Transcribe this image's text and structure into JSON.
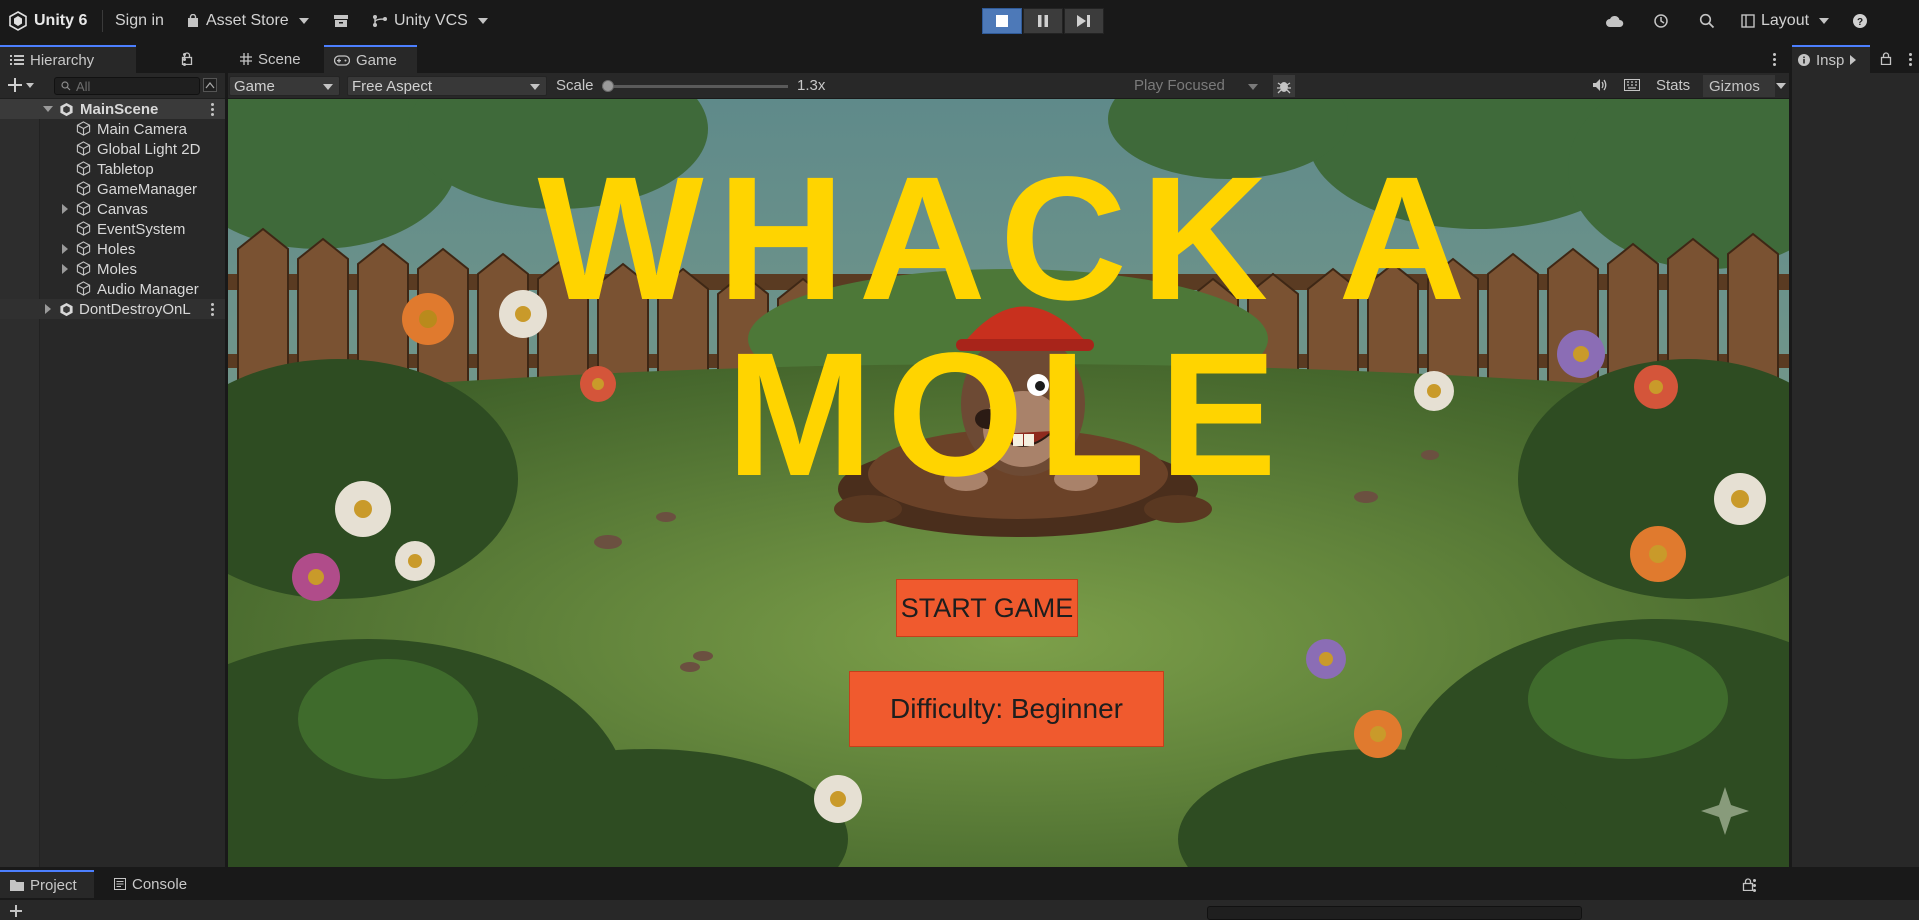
{
  "topbar": {
    "unity_label": "Unity 6",
    "sign_in": "Sign in",
    "asset_store": "Asset Store",
    "vcs": "Unity VCS",
    "layout": "Layout"
  },
  "hierarchy": {
    "tab": "Hierarchy",
    "search_placeholder": "All",
    "scene": "MainScene",
    "items": [
      {
        "label": "Main Camera",
        "expandable": false
      },
      {
        "label": "Global Light 2D",
        "expandable": false
      },
      {
        "label": "Tabletop",
        "expandable": false
      },
      {
        "label": "GameManager",
        "expandable": false
      },
      {
        "label": "Canvas",
        "expandable": true
      },
      {
        "label": "EventSystem",
        "expandable": false
      },
      {
        "label": "Holes",
        "expandable": true
      },
      {
        "label": "Moles",
        "expandable": true
      },
      {
        "label": "Audio Manager",
        "expandable": false
      }
    ],
    "dont_destroy": "DontDestroyOnL"
  },
  "game_panel": {
    "scene_tab": "Scene",
    "game_tab": "Game",
    "display_dropdown": "Game",
    "aspect_dropdown": "Free Aspect",
    "scale_label": "Scale",
    "scale_value": "1.3x",
    "scale_fraction": 0.0,
    "play_mode": "Play Focused",
    "stats": "Stats",
    "gizmos": "Gizmos"
  },
  "game": {
    "title": "WHACK A MOLE",
    "start_button": "START GAME",
    "difficulty_button": "Difficulty: Beginner",
    "colors": {
      "title": "#ffd400",
      "button": "#f05a2e"
    }
  },
  "inspector": {
    "tab": "Insp"
  },
  "bottom": {
    "project_tab": "Project",
    "console_tab": "Console"
  }
}
